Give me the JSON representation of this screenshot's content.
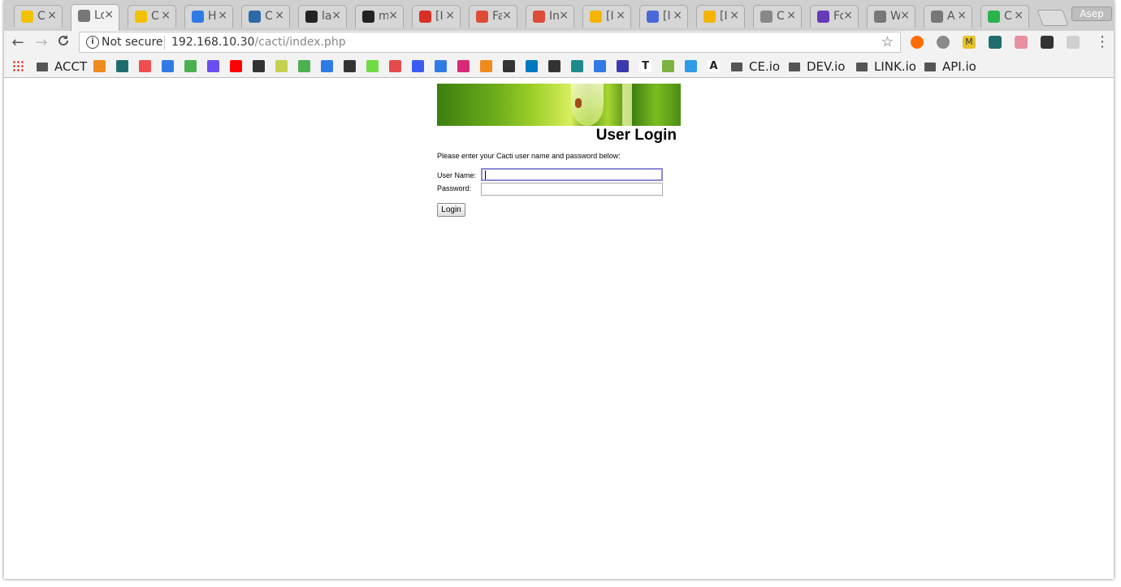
{
  "browser": {
    "tabs": [
      {
        "title": "C",
        "favicon": "linux-penguin-icon",
        "color": "#f2c200"
      },
      {
        "title": "Lo",
        "favicon": "page-icon",
        "color": "#777777",
        "active": true
      },
      {
        "title": "C",
        "favicon": "linux-penguin-icon",
        "color": "#f2c200"
      },
      {
        "title": "H",
        "favicon": "digitalocean-icon",
        "color": "#2f7ae5"
      },
      {
        "title": "C",
        "favicon": "xda-icon",
        "color": "#2c6aa7"
      },
      {
        "title": "la",
        "favicon": "github-icon",
        "color": "#222222"
      },
      {
        "title": "m",
        "favicon": "github-icon",
        "color": "#222222"
      },
      {
        "title": "[I",
        "favicon": "gmail-icon",
        "color": "#d93025"
      },
      {
        "title": "Fa",
        "favicon": "google-plus-icon",
        "color": "#dd4b39"
      },
      {
        "title": "In",
        "favicon": "google-plus-icon",
        "color": "#dd4b39"
      },
      {
        "title": "[I",
        "favicon": "slides-icon",
        "color": "#f4b400"
      },
      {
        "title": "[I",
        "favicon": "docs-icon",
        "color": "#4a68d8"
      },
      {
        "title": "[I",
        "favicon": "slides-icon",
        "color": "#f4b400"
      },
      {
        "title": "C",
        "favicon": "cacti-icon",
        "color": "#888888"
      },
      {
        "title": "Fo",
        "favicon": "forms-icon",
        "color": "#673ab7"
      },
      {
        "title": "W",
        "favicon": "page-icon",
        "color": "#777777"
      },
      {
        "title": "A",
        "favicon": "page-icon",
        "color": "#777777"
      },
      {
        "title": "C",
        "favicon": "app-icon",
        "color": "#2bb24c"
      }
    ],
    "close_glyph": "×",
    "profile_name": "Asep",
    "back_glyph": "←",
    "forward_glyph": "→",
    "reload_glyph": "C",
    "security_label": "Not secure",
    "url_host": "192.168.10.30",
    "url_path": "/cacti/index.php",
    "star_glyph": "☆",
    "menu_glyph": "⋮",
    "extensions": [
      {
        "name": "extension-orange-icon",
        "color": "#ff6d00"
      },
      {
        "name": "extension-gray-icon",
        "color": "#8a8a8a"
      },
      {
        "name": "extension-m-icon",
        "color": "#e6c229",
        "text": "M"
      },
      {
        "name": "extension-check-icon",
        "color": "#1f6e6e"
      },
      {
        "name": "extension-eraser-icon",
        "color": "#e88fa0"
      },
      {
        "name": "extension-crop-icon",
        "color": "#333333"
      },
      {
        "name": "extension-disabled-icon",
        "color": "#d0d0d0"
      }
    ],
    "bookmarks": {
      "acct_label": "ACCT",
      "icons": [
        {
          "name": "bm-share-icon",
          "color": "#f18a1c"
        },
        {
          "name": "bm-check-icon",
          "color": "#1f6e6e"
        },
        {
          "name": "bm-target-icon",
          "color": "#f04e4e"
        },
        {
          "name": "bm-ring-icon",
          "color": "#2f7ae5"
        },
        {
          "name": "bm-code-icon",
          "color": "#4caf50"
        },
        {
          "name": "bm-pocket-icon",
          "color": "#6c4ef2"
        },
        {
          "name": "bm-youtube-icon",
          "color": "#ff0000"
        },
        {
          "name": "bm-filter-icon",
          "color": "#333333"
        },
        {
          "name": "bm-g-icon",
          "color": "#c5d04f"
        },
        {
          "name": "bm-w3-icon",
          "color": "#4caf50"
        },
        {
          "name": "bm-power-icon",
          "color": "#2f7ae5"
        },
        {
          "name": "bm-search-icon",
          "color": "#333333"
        },
        {
          "name": "bm-upwork-icon",
          "color": "#6fda44"
        },
        {
          "name": "bm-colorwheel-icon",
          "color": "#e54b4b"
        },
        {
          "name": "bm-arrow-icon",
          "color": "#3a5af0"
        },
        {
          "name": "bm-globe-icon",
          "color": "#2f7ae5"
        },
        {
          "name": "bm-instagram-icon",
          "color": "#d62976"
        },
        {
          "name": "bm-tiles-icon",
          "color": "#f18a1c"
        },
        {
          "name": "bm-box-icon",
          "color": "#333333"
        },
        {
          "name": "bm-trello-icon",
          "color": "#0079bf"
        },
        {
          "name": "bm-play-icon",
          "color": "#333333"
        },
        {
          "name": "bm-s-icon",
          "color": "#1f8a8a"
        },
        {
          "name": "bm-network-icon",
          "color": "#2f7ae5"
        },
        {
          "name": "bm-emblem-icon",
          "color": "#3a3ab0"
        },
        {
          "name": "bm-t-icon",
          "color": "#222222",
          "text": "T"
        },
        {
          "name": "bm-android-icon",
          "color": "#7cb342"
        },
        {
          "name": "bm-gear-icon",
          "color": "#2f9ae5"
        },
        {
          "name": "bm-a-icon",
          "color": "#222222",
          "text": "A"
        }
      ],
      "folders": [
        "CE.io",
        "DEV.io",
        "LINK.io",
        "API.io"
      ]
    }
  },
  "page": {
    "title": "User Login",
    "instructions": "Please enter your Cacti user name and password below:",
    "username_label": "User Name:",
    "password_label": "Password:",
    "username_value": "",
    "password_value": "",
    "login_button": "Login"
  }
}
